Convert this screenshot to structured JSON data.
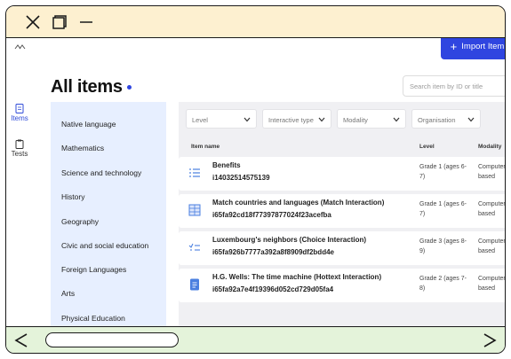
{
  "sidebar_rail": {
    "items": [
      {
        "label": "Items"
      },
      {
        "label": "Tests"
      }
    ]
  },
  "header": {
    "title": "All items",
    "import_label": "Import Item",
    "search_placeholder": "Search item by ID or title"
  },
  "categories": [
    {
      "label": "Native language"
    },
    {
      "label": "Mathematics"
    },
    {
      "label": "Science and technology"
    },
    {
      "label": "History"
    },
    {
      "label": "Geography"
    },
    {
      "label": "Civic and social education"
    },
    {
      "label": "Foreign Languages"
    },
    {
      "label": "Arts"
    },
    {
      "label": "Physical Education"
    }
  ],
  "filters": [
    {
      "label": "Level"
    },
    {
      "label": "Interactive type"
    },
    {
      "label": "Modality"
    },
    {
      "label": "Organisation"
    }
  ],
  "table": {
    "columns": [
      "Item name",
      "Level",
      "Modality"
    ],
    "rows": [
      {
        "title": "Benefits",
        "id": "i14032514575139",
        "level": "Grade 1 (ages 6-7)",
        "modality": "Computer based",
        "icon": "list-icon"
      },
      {
        "title": "Match countries and languages (Match Interaction)",
        "id": "i65fa92cd18f77397877024f23acefba",
        "level": "Grade 1 (ages 6-7)",
        "modality": "Computer based",
        "icon": "grid-icon"
      },
      {
        "title": "Luxembourg's neighbors (Choice Interaction)",
        "id": "i65fa926b7777a392a8f8909df2bdd4e",
        "level": "Grade 3 (ages 8-9)",
        "modality": "Computer based",
        "icon": "choice-icon"
      },
      {
        "title": "H.G. Wells: The time machine (Hottext Interaction)",
        "id": "i65fa92a7e4f19396d052cd729d05fa4",
        "level": "Grade 2 (ages 7-8)",
        "modality": "Computer based",
        "icon": "document-icon"
      }
    ]
  },
  "colors": {
    "accent": "#2f45e0",
    "category_bg": "#e7efff",
    "top_chrome": "#fdf0d0",
    "bottom_chrome": "#e4f3da"
  }
}
